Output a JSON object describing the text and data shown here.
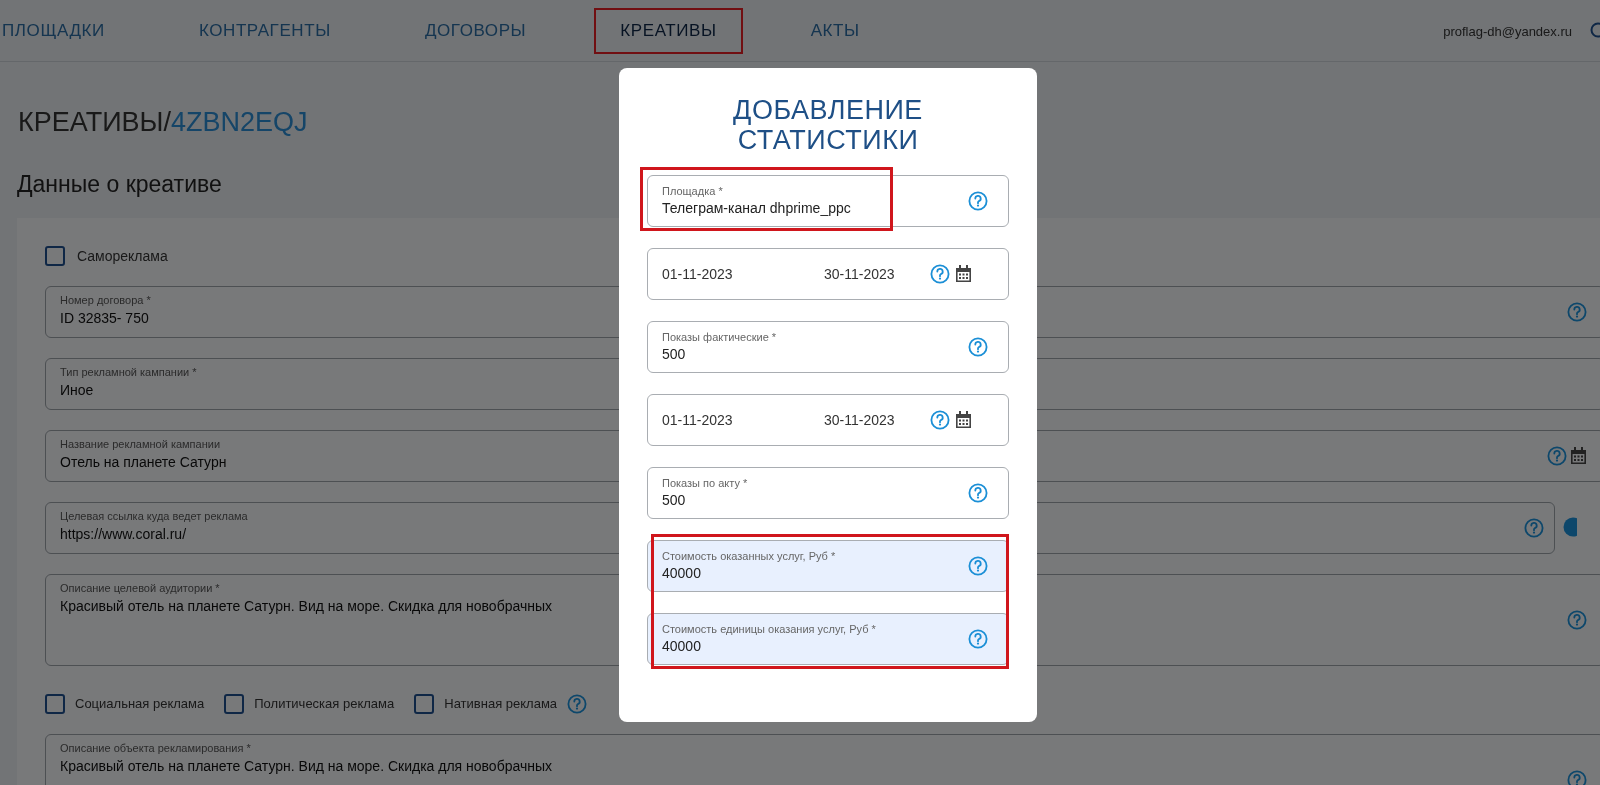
{
  "nav": {
    "items": [
      {
        "label": "ПЛОЩАДКИ",
        "selected": false,
        "highlighted": false
      },
      {
        "label": "КОНТРАГЕНТЫ",
        "selected": false,
        "highlighted": false
      },
      {
        "label": "ДОГОВОРЫ",
        "selected": false,
        "highlighted": false
      },
      {
        "label": "КРЕАТИВЫ",
        "selected": true,
        "highlighted": true
      },
      {
        "label": "АКТЫ",
        "selected": false,
        "highlighted": false
      }
    ],
    "user_email": "proflag-dh@yandex.ru"
  },
  "breadcrumb": {
    "section": "КРЕАТИВЫ/",
    "id": "4ZBN2EQJ"
  },
  "section_title": "Данные о креативе",
  "form": {
    "items": [
      {
        "kind": "checkbox",
        "label": "Самореклама",
        "checked": false
      },
      {
        "kind": "field",
        "label": "Номер договора *",
        "value": "ID 32835- 750",
        "help": true
      },
      {
        "kind": "field",
        "label": "Тип рекламной кампании *",
        "value": "Иное"
      },
      {
        "kind": "field",
        "label": "Название рекламной кампании",
        "value": "Отель на планете Сатурн",
        "help": true,
        "calendar": true
      },
      {
        "kind": "field",
        "label": "Целевая ссылка куда ведет реклама",
        "value": "https://www.coral.ru/",
        "help": true,
        "side_button": true
      },
      {
        "kind": "textarea",
        "label": "Описание целевой аудитории *",
        "value": "Красивый отель на планете Сатурн. Вид на море. Скидка для новобрачных",
        "help": true
      },
      {
        "kind": "checkbox_row",
        "options": [
          {
            "label": "Социальная реклама",
            "checked": false
          },
          {
            "label": "Политическая реклама",
            "checked": false
          },
          {
            "label": "Нативная реклама",
            "checked": false,
            "help": true
          }
        ]
      },
      {
        "kind": "textarea",
        "label": "Описание объекта рекламирования *",
        "value": "Красивый отель на планете Сатурн. Вид на море. Скидка для новобрачных",
        "help": true
      }
    ]
  },
  "modal": {
    "title": "ДОБАВЛЕНИЕ СТАТИСТИКИ",
    "fields": [
      {
        "kind": "field",
        "label": "Площадка *",
        "value": "Телеграм-канал dhprime_ppc",
        "help": true,
        "autofilled": false,
        "highlighted": true
      },
      {
        "kind": "date_range",
        "from": "01-11-2023",
        "to": "30-11-2023",
        "help": true,
        "calendar": true,
        "autofilled": false,
        "highlighted": false
      },
      {
        "kind": "field",
        "label": "Показы фактические *",
        "value": "500",
        "help": true,
        "autofilled": false,
        "highlighted": false
      },
      {
        "kind": "date_range",
        "from": "01-11-2023",
        "to": "30-11-2023",
        "help": true,
        "calendar": true,
        "autofilled": false,
        "highlighted": false
      },
      {
        "kind": "field",
        "label": "Показы по акту *",
        "value": "500",
        "help": true,
        "autofilled": false,
        "highlighted": false
      },
      {
        "kind": "field",
        "label": "Стоимость оказанных услуг, Руб *",
        "value": "40000",
        "help": true,
        "autofilled": true,
        "highlighted": true
      },
      {
        "kind": "field",
        "label": "Стоимость единицы оказания услуг, Руб *",
        "value": "40000",
        "help": true,
        "autofilled": true,
        "highlighted": true
      }
    ]
  }
}
